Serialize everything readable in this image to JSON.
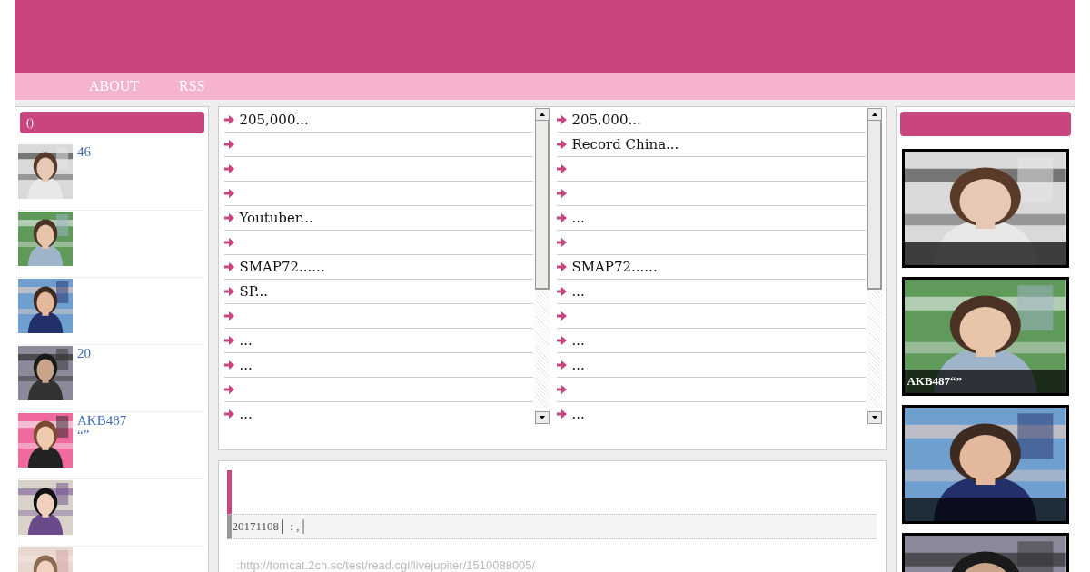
{
  "nav": {
    "links": [
      "ABOUT",
      "RSS"
    ]
  },
  "left_sidebar": {
    "title": "()",
    "items": [
      {
        "kind": "picture",
        "title": "46"
      },
      {
        "kind": "picture"
      },
      {
        "kind": "picture"
      },
      {
        "kind": "picture",
        "title": "20"
      },
      {
        "kind": "picture",
        "title": "AKB487",
        "subtitle": "“”"
      },
      {
        "kind": "picture"
      },
      {
        "kind": "picture"
      }
    ]
  },
  "link_lists": [
    {
      "items": [
        {
          "kind": "link",
          "text": "205,000..."
        },
        {
          "kind": "blank"
        },
        {
          "kind": "blank"
        },
        {
          "kind": "blank"
        },
        {
          "kind": "link",
          "text": "Youtuber..."
        },
        {
          "kind": "blank"
        },
        {
          "kind": "link",
          "text": "SMAP72......"
        },
        {
          "kind": "link",
          "text": "SP..."
        },
        {
          "kind": "blank"
        },
        {
          "kind": "link",
          "text": "..."
        },
        {
          "kind": "link",
          "text": "..."
        },
        {
          "kind": "blank"
        },
        {
          "kind": "link",
          "text": "..."
        }
      ]
    },
    {
      "items": [
        {
          "kind": "link",
          "text": "205,000..."
        },
        {
          "kind": "link",
          "text": "Record China..."
        },
        {
          "kind": "blank"
        },
        {
          "kind": "blank"
        },
        {
          "kind": "link",
          "text": " ..."
        },
        {
          "kind": "blank"
        },
        {
          "kind": "link",
          "text": "SMAP72......"
        },
        {
          "kind": "link",
          "text": "..."
        },
        {
          "kind": "blank"
        },
        {
          "kind": "link",
          "text": "..."
        },
        {
          "kind": "link",
          "text": "..."
        },
        {
          "kind": "blank"
        },
        {
          "kind": "link",
          "text": "..."
        }
      ]
    }
  ],
  "article": {
    "meta": "20171108│ : ,│",
    "source": ":http://tomcat.2ch.sc/test/read.cgi/livejupiter/1510088005/"
  },
  "right_sidebar": {
    "cards": [
      {
        "kind": "picture",
        "caption_bar": true
      },
      {
        "kind": "picture",
        "caption_bar": true,
        "caption": "AKB487“”"
      },
      {
        "kind": "picture",
        "caption_bar": true
      },
      {
        "kind": "picture"
      }
    ]
  }
}
